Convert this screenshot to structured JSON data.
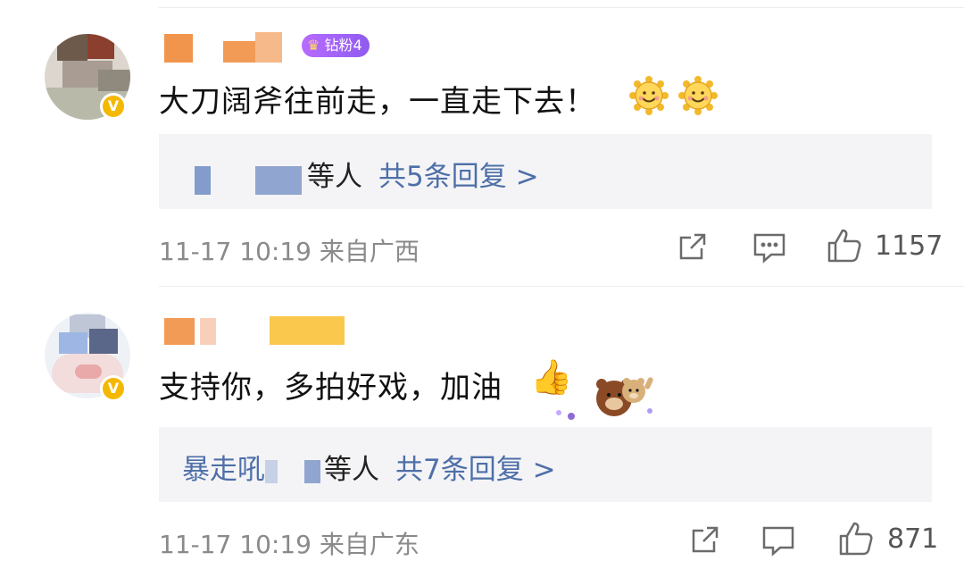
{
  "comments": [
    {
      "badge": "钻粉4",
      "text": "大刀阔斧往前走，一直走下去！",
      "replies": {
        "who": "等人",
        "link": "共5条回复 >"
      },
      "meta": "11-17 10:19 来自广西",
      "likes": "1157"
    },
    {
      "text": "支持你，多拍好戏，加油",
      "replies": {
        "who_prefix": "暴走吼",
        "who": "等人",
        "link": "共7条回复 >"
      },
      "meta": "11-17 10:19 来自广东",
      "likes": "871"
    }
  ],
  "icons": {
    "verified": "V",
    "share": "share-icon",
    "comment": "comment-icon",
    "like": "thumbs-up-icon",
    "sun_emoji": "sun-smile-emoji",
    "thumbs_emoji": "👍"
  },
  "colors": {
    "link": "#4e6fa8",
    "verified": "#f5b800",
    "badge": "#a965ff"
  }
}
